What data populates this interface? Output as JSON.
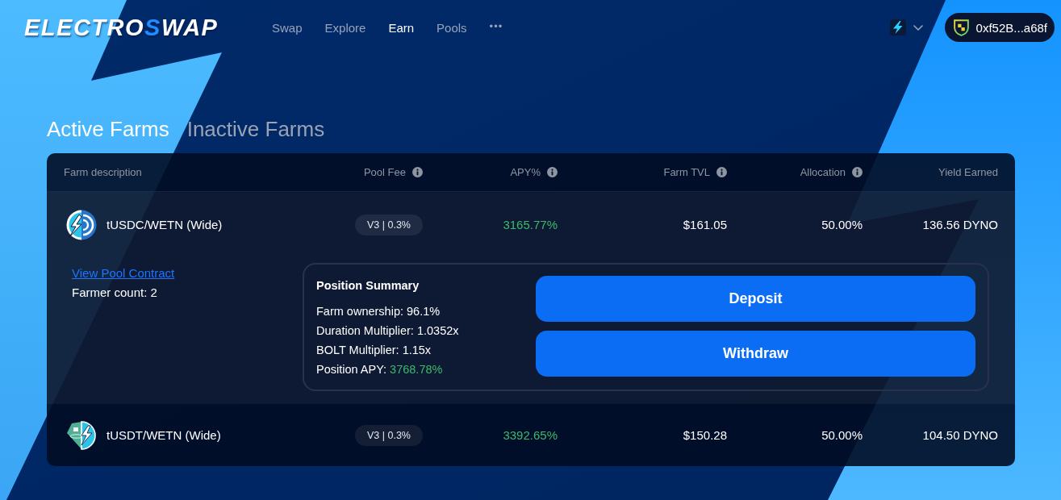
{
  "header": {
    "logo": {
      "parts": [
        {
          "text": "ELECTRO",
          "accent": false
        },
        {
          "text": "S",
          "accent": true
        },
        {
          "text": "WAP",
          "accent": false
        }
      ]
    },
    "nav": [
      {
        "label": "Swap",
        "selected": false
      },
      {
        "label": "Explore",
        "selected": false
      },
      {
        "label": "Earn",
        "selected": true
      },
      {
        "label": "Pools",
        "selected": false
      }
    ],
    "more": "•••",
    "wallet": {
      "address": "0xf52B...a68f"
    }
  },
  "tabs": [
    {
      "label": "Active Farms",
      "selected": true
    },
    {
      "label": "Inactive Farms",
      "selected": false
    }
  ],
  "table": {
    "columns": [
      {
        "label": "Farm description",
        "info": false
      },
      {
        "label": "Pool Fee",
        "info": true
      },
      {
        "label": "APY%",
        "info": true
      },
      {
        "label": "Farm TVL",
        "info": true
      },
      {
        "label": "Allocation",
        "info": true
      },
      {
        "label": "Yield Earned",
        "info": false
      }
    ],
    "rows": [
      {
        "kind": "usdc",
        "name": "tUSDC/WETN (Wide)",
        "pool_fee": "V3 | 0.3%",
        "apy": "3165.77%",
        "tvl": "$161.05",
        "allocation": "50.00%",
        "yield": "136.56 DYNO",
        "expanded": true,
        "details": {
          "link": "View Pool Contract",
          "farmer_count": "Farmer count: 2",
          "summary": {
            "title": "Position Summary",
            "lines": [
              {
                "label": "Farm ownership:",
                "value": "96.1%",
                "highlight": false
              },
              {
                "label": "Duration Multiplier:",
                "value": "1.0352x",
                "highlight": false
              },
              {
                "label": "BOLT Multiplier:",
                "value": "1.15x",
                "highlight": false
              },
              {
                "label": "Position APY:",
                "value": "3768.78%",
                "highlight": true
              }
            ]
          },
          "buttons": [
            "Deposit",
            "Withdraw"
          ]
        }
      },
      {
        "kind": "usdt",
        "name": "tUSDT/WETN (Wide)",
        "pool_fee": "V3 | 0.3%",
        "apy": "3392.65%",
        "tvl": "$150.28",
        "allocation": "50.00%",
        "yield": "104.50 DYNO",
        "expanded": false
      }
    ]
  }
}
